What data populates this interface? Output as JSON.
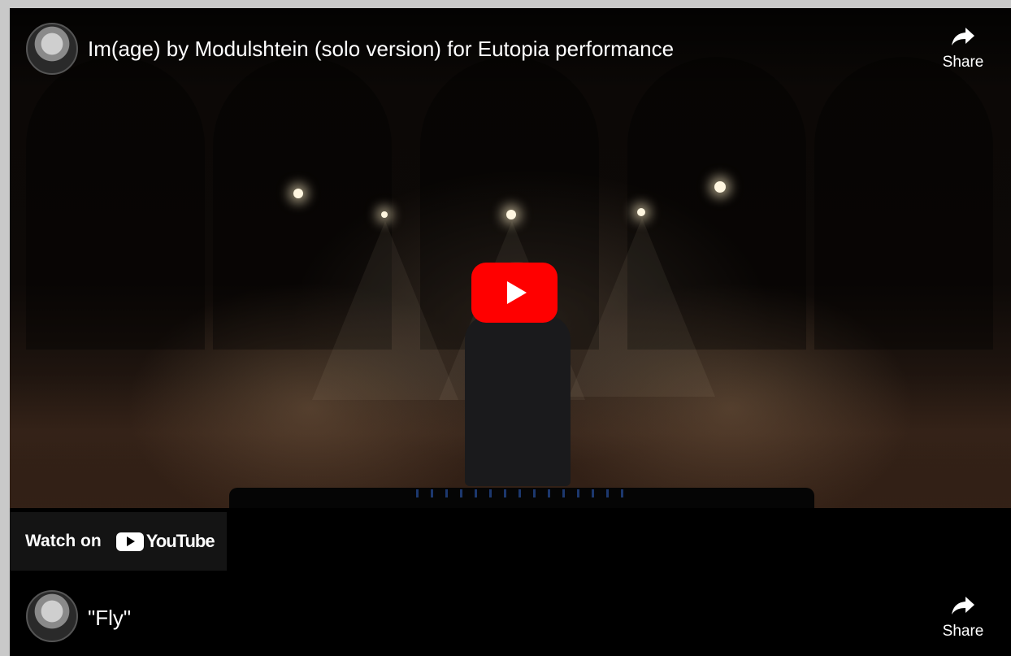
{
  "video": {
    "title": "Im(age) by Modulshtein (solo version) for Eutopia performance",
    "share_label": "Share",
    "play_button_color": "#ff0000",
    "play_icon": "play-icon"
  },
  "watch_on": {
    "label": "Watch on",
    "brand": "YouTube"
  },
  "next_item": {
    "title": "\"Fly\"",
    "share_label": "Share"
  },
  "colors": {
    "background": "#c9c9c9",
    "player": "#000000",
    "youtube_red": "#ff0000"
  }
}
